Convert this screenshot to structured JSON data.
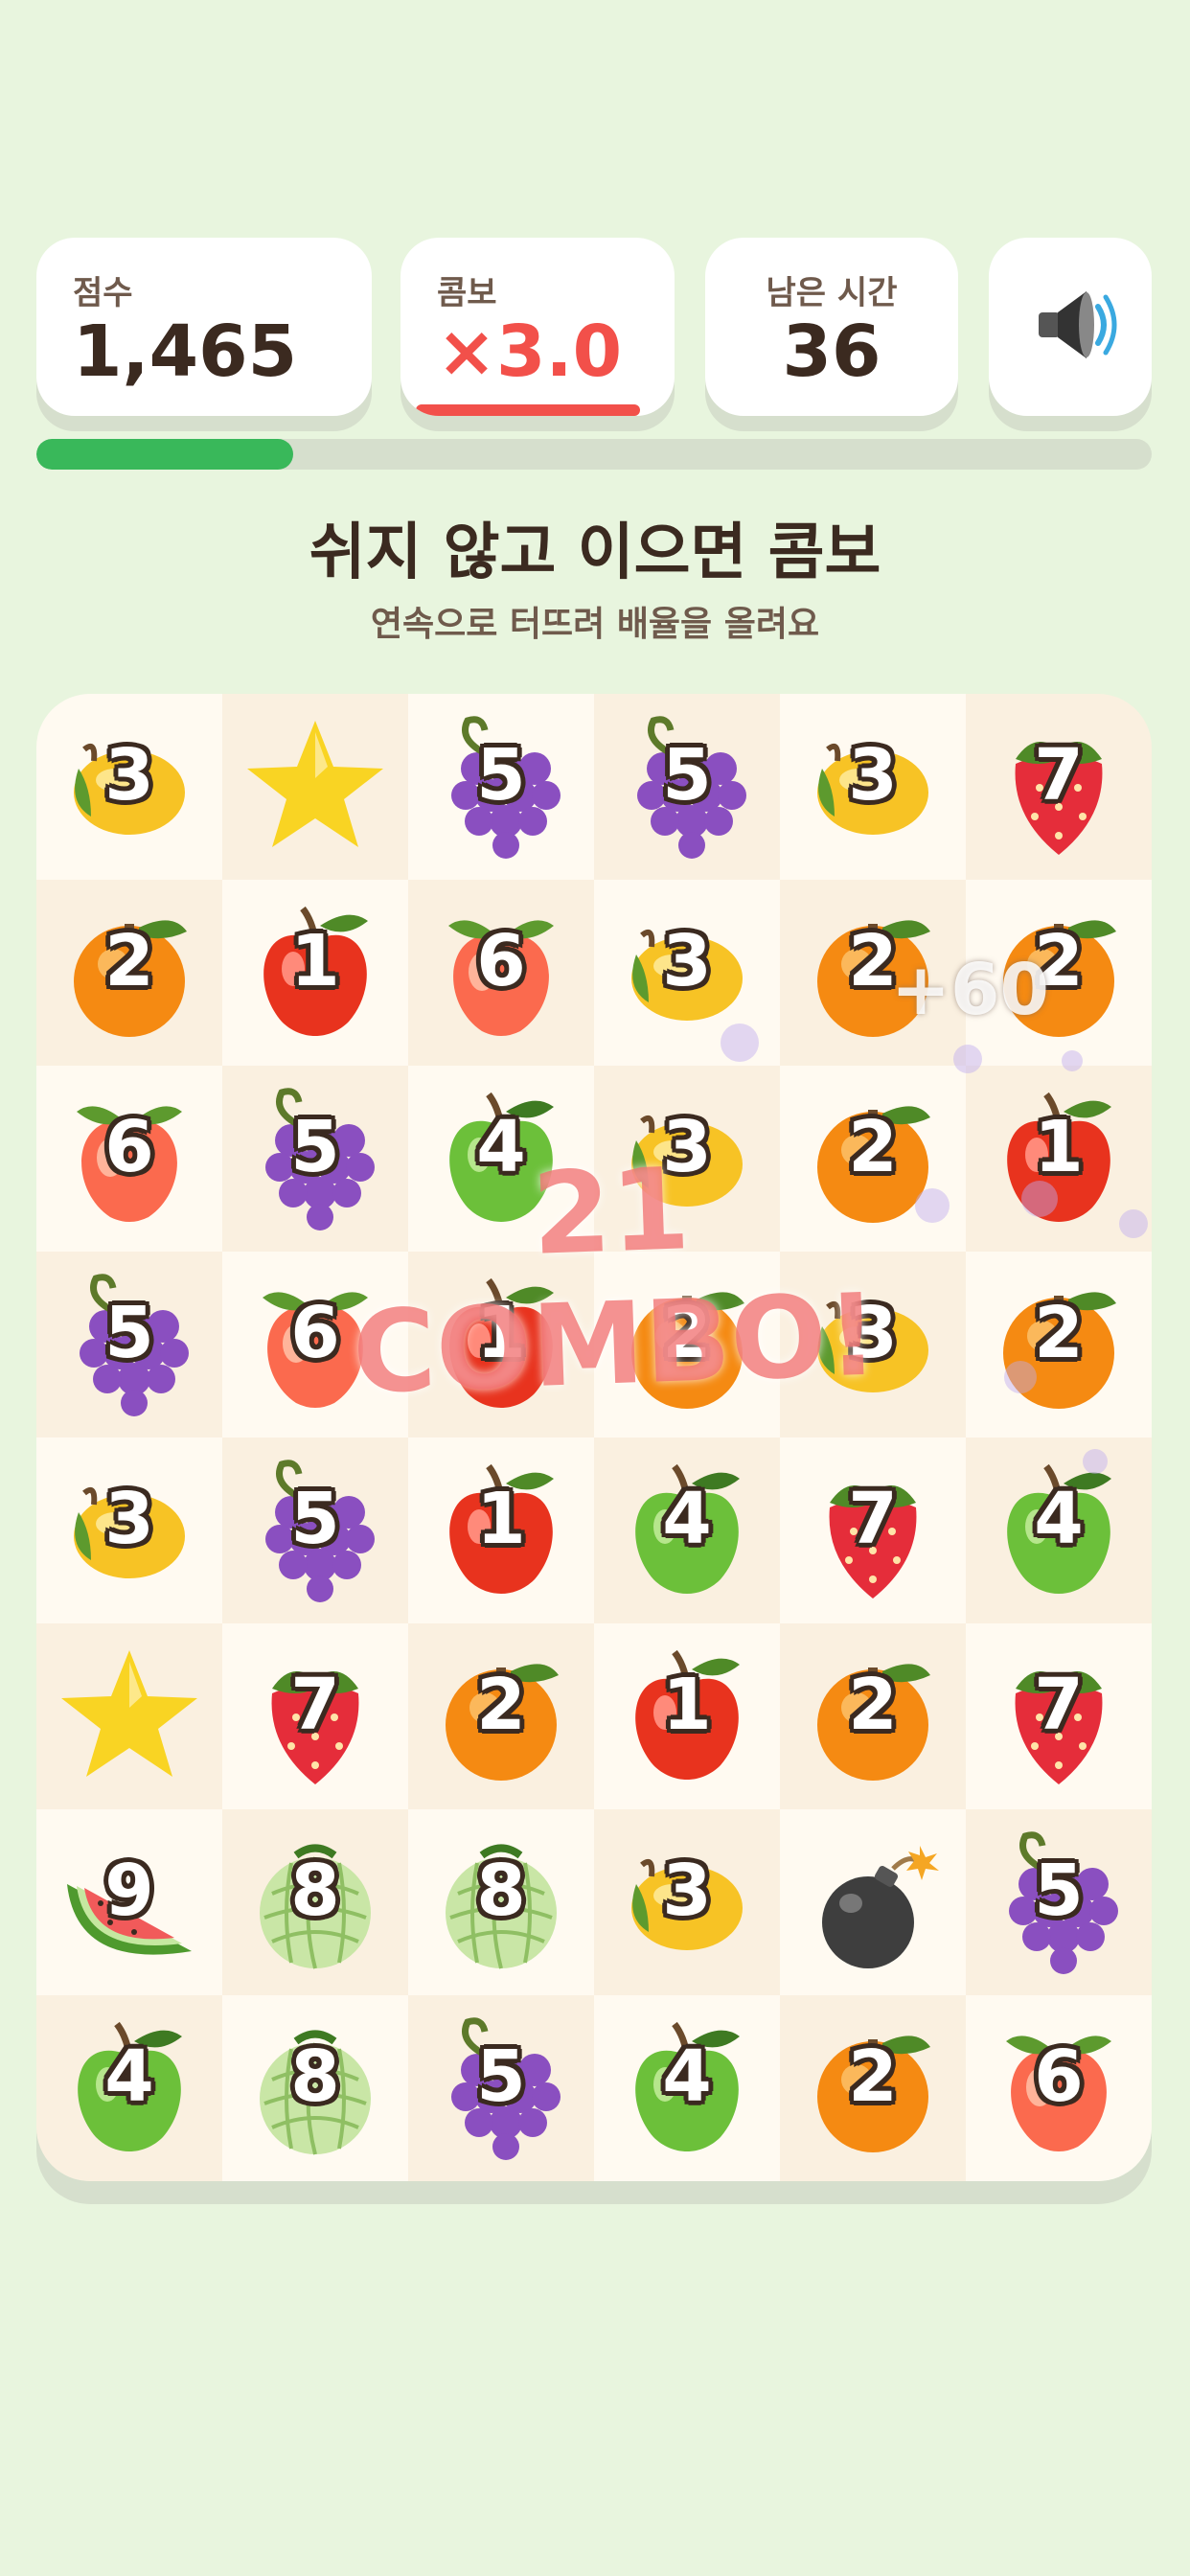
{
  "hud": {
    "score": {
      "label": "점수",
      "value": "1,465"
    },
    "combo": {
      "label": "콤보",
      "value": "×3.0"
    },
    "time": {
      "label": "남은 시간",
      "value": "36"
    },
    "sound_icon": "speaker-icon"
  },
  "progress": {
    "fraction": 0.23
  },
  "headline": "쉬지 않고 이으면 콤보",
  "subline": "연속으로 터뜨려 배율을 올려요",
  "combo_banner": "21 COMBO!",
  "points_popup": "+60",
  "colors": {
    "background": "#e8f5de",
    "combo_red": "#f2504a",
    "progress_green": "#39b85a",
    "text_dark": "#3b2a20"
  },
  "board": {
    "rows": [
      [
        {
          "fruit": "lemon",
          "num": "3"
        },
        {
          "fruit": "star",
          "num": ""
        },
        {
          "fruit": "grape",
          "num": "5"
        },
        {
          "fruit": "grape",
          "num": "5"
        },
        {
          "fruit": "lemon",
          "num": "3"
        },
        {
          "fruit": "strawberry",
          "num": "7"
        }
      ],
      [
        {
          "fruit": "orange",
          "num": "2"
        },
        {
          "fruit": "apple",
          "num": "1"
        },
        {
          "fruit": "peach",
          "num": "6"
        },
        {
          "fruit": "lemon",
          "num": "3"
        },
        {
          "fruit": "orange",
          "num": "2"
        },
        {
          "fruit": "orange",
          "num": "2"
        }
      ],
      [
        {
          "fruit": "peach",
          "num": "6"
        },
        {
          "fruit": "grape",
          "num": "5"
        },
        {
          "fruit": "green-apple",
          "num": "4"
        },
        {
          "fruit": "lemon",
          "num": "3"
        },
        {
          "fruit": "orange",
          "num": "2"
        },
        {
          "fruit": "apple",
          "num": "1"
        }
      ],
      [
        {
          "fruit": "grape",
          "num": "5"
        },
        {
          "fruit": "peach",
          "num": "6"
        },
        {
          "fruit": "apple",
          "num": "1"
        },
        {
          "fruit": "orange",
          "num": "2"
        },
        {
          "fruit": "lemon",
          "num": "3"
        },
        {
          "fruit": "orange",
          "num": "2"
        }
      ],
      [
        {
          "fruit": "lemon",
          "num": "3"
        },
        {
          "fruit": "grape",
          "num": "5"
        },
        {
          "fruit": "apple",
          "num": "1"
        },
        {
          "fruit": "green-apple",
          "num": "4"
        },
        {
          "fruit": "strawberry",
          "num": "7"
        },
        {
          "fruit": "green-apple",
          "num": "4"
        }
      ],
      [
        {
          "fruit": "star",
          "num": ""
        },
        {
          "fruit": "strawberry",
          "num": "7"
        },
        {
          "fruit": "orange",
          "num": "2"
        },
        {
          "fruit": "apple",
          "num": "1"
        },
        {
          "fruit": "orange",
          "num": "2"
        },
        {
          "fruit": "strawberry",
          "num": "7"
        }
      ],
      [
        {
          "fruit": "watermelon",
          "num": "9"
        },
        {
          "fruit": "melon",
          "num": "8"
        },
        {
          "fruit": "melon",
          "num": "8"
        },
        {
          "fruit": "lemon",
          "num": "3"
        },
        {
          "fruit": "bomb",
          "num": ""
        },
        {
          "fruit": "grape",
          "num": "5"
        }
      ],
      [
        {
          "fruit": "green-apple",
          "num": "4"
        },
        {
          "fruit": "melon",
          "num": "8"
        },
        {
          "fruit": "grape",
          "num": "5"
        },
        {
          "fruit": "green-apple",
          "num": "4"
        },
        {
          "fruit": "orange",
          "num": "2"
        },
        {
          "fruit": "peach",
          "num": "6"
        }
      ]
    ]
  }
}
